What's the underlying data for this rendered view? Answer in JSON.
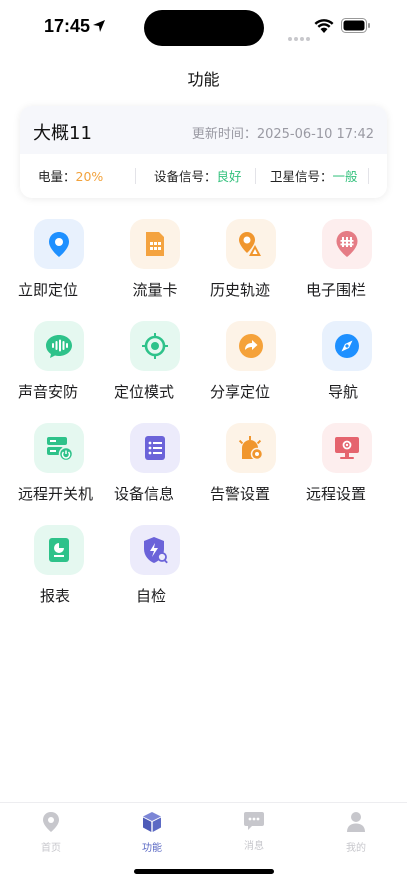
{
  "status": {
    "time": "17:45"
  },
  "page": {
    "title": "功能"
  },
  "device": {
    "name": "大概11",
    "update_label": "更新时间：",
    "update_time": "2025-06-10 17:42",
    "battery_label": "电量：",
    "battery_value": "20%",
    "signal_label": "设备信号：",
    "signal_value": "良好",
    "satellite_label": "卫星信号：",
    "satellite_value": "一般"
  },
  "features": [
    {
      "label": "立即定位",
      "icon": "location-pin-icon"
    },
    {
      "label": "流量卡",
      "icon": "sim-card-icon"
    },
    {
      "label": "历史轨迹",
      "icon": "track-history-icon"
    },
    {
      "label": "电子围栏",
      "icon": "geofence-icon"
    },
    {
      "label": "声音安防",
      "icon": "voice-wave-icon"
    },
    {
      "label": "定位模式",
      "icon": "crosshair-icon"
    },
    {
      "label": "分享定位",
      "icon": "share-arrow-icon"
    },
    {
      "label": "导航",
      "icon": "compass-icon"
    },
    {
      "label": "远程开关机",
      "icon": "remote-power-icon"
    },
    {
      "label": "设备信息",
      "icon": "device-info-icon"
    },
    {
      "label": "告警设置",
      "icon": "alarm-settings-icon"
    },
    {
      "label": "远程设置",
      "icon": "remote-settings-icon"
    },
    {
      "label": "报表",
      "icon": "report-icon"
    },
    {
      "label": "自检",
      "icon": "self-check-icon"
    }
  ],
  "tabs": [
    {
      "label": "首页",
      "icon": "home-pin-icon"
    },
    {
      "label": "功能",
      "icon": "cube-icon"
    },
    {
      "label": "消息",
      "icon": "message-icon"
    },
    {
      "label": "我的",
      "icon": "profile-icon"
    }
  ],
  "colors": {
    "accent": "#5c6ac4",
    "battery": "#f2a23c",
    "good": "#34c17d"
  }
}
